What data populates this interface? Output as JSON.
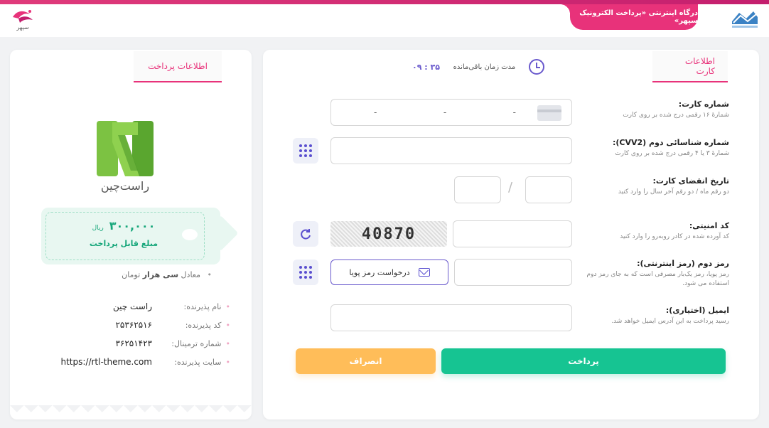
{
  "header": {
    "gateway_title": "درگاه اینترنتی «پرداخت الکترونیک سپهر»",
    "brand_text": "سپهر"
  },
  "main": {
    "tab_label": "اطلاعات کارت",
    "timer": {
      "label": "مدت زمان باقی‌مانده",
      "value": "۰۹ : ۳۵"
    },
    "fields": {
      "card_number": {
        "label": "شماره کارت:",
        "hint": "شمارهٔ ۱۶ رقمی درج شده بر روی کارت",
        "separator": "-"
      },
      "cvv2": {
        "label": "شماره شناسائی دوم (CVV2):",
        "hint": "شمارهٔ ۳ یا ۴ رقمی درج شده بر روی کارت"
      },
      "expiry": {
        "label": "تاریخ انقضای کارت:",
        "hint": "دو رقم ماه / دو رقم آخر سال را وارد کنید",
        "separator": "/"
      },
      "captcha": {
        "label": "کد امنیتی:",
        "hint": "کد آورده شده در کادر روبه‌رو را وارد کنید",
        "image_text": "40870"
      },
      "second_password": {
        "label": "رمز دوم (رمز اینترنتی):",
        "hint": "رمز پویا، رمز یک‌بار مصرفی است که به جای رمز دوم استفاده می شود.",
        "request_label": "درخواست رمز پویا"
      },
      "email": {
        "label": "ایمیل (اختیاری):",
        "hint": "رسید پرداخت به این آدرس ایمیل خواهد شد."
      }
    },
    "buttons": {
      "pay": "پرداخت",
      "cancel": "انصراف"
    }
  },
  "side": {
    "tab_label": "اطلاعات پرداخت",
    "merchant_brand": "راست‌چین",
    "amount": {
      "value": "۳۰۰,۰۰۰",
      "currency": "ریال",
      "caption": "مبلغ قابل پرداخت"
    },
    "equivalent": {
      "prefix": "معادل",
      "words": "سی هزار",
      "suffix": "تومان"
    },
    "details": [
      {
        "key": "نام پذیرنده:",
        "value": "راست چین"
      },
      {
        "key": "کد پذیرنده:",
        "value": "۲۵۳۶۲۵۱۶"
      },
      {
        "key": "شماره ترمینال:",
        "value": "۳۶۲۵۱۴۲۳"
      },
      {
        "key": "سایت پذیرنده:",
        "value": "https://rtl-theme.com"
      }
    ]
  },
  "colors": {
    "brand_pink": "#e8327a",
    "accent_purple": "#5a4fcf",
    "pay_green": "#16c492",
    "cancel_orange": "#ffbd59"
  }
}
